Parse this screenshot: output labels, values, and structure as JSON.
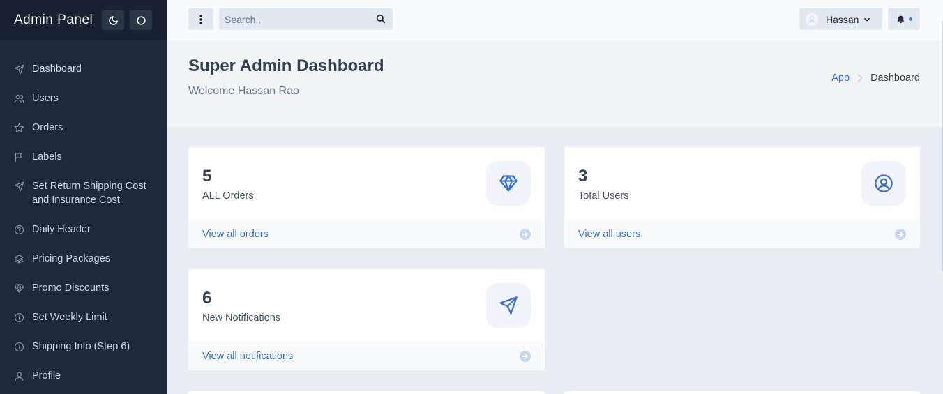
{
  "brand": {
    "title": "Admin Panel",
    "moon_icon": "moon-icon",
    "circle_icon": "circle-icon"
  },
  "sidebar": {
    "items": [
      {
        "label": "Dashboard",
        "icon": "send-icon"
      },
      {
        "label": "Users",
        "icon": "users-icon"
      },
      {
        "label": "Orders",
        "icon": "star-icon"
      },
      {
        "label": "Labels",
        "icon": "flag-icon"
      },
      {
        "label": "Set Return Shipping Cost and Insurance Cost",
        "icon": "send-icon"
      },
      {
        "label": "Daily Header",
        "icon": "help-circle-icon"
      },
      {
        "label": "Pricing Packages",
        "icon": "layers-icon"
      },
      {
        "label": "Promo Discounts",
        "icon": "diamond-icon"
      },
      {
        "label": "Set Weekly Limit",
        "icon": "info-icon"
      },
      {
        "label": "Shipping Info (Step 6)",
        "icon": "info-icon"
      },
      {
        "label": "Profile",
        "icon": "user-icon"
      }
    ]
  },
  "topbar": {
    "search_placeholder": "Search..",
    "user_name": "Hassan"
  },
  "header": {
    "title": "Super Admin Dashboard",
    "subtitle": "Welcome Hassan Rao",
    "breadcrumb": {
      "parent": "App",
      "current": "Dashboard"
    }
  },
  "cards": [
    {
      "value": "5",
      "label": "ALL Orders",
      "link": "View all orders",
      "icon": "diamond-icon"
    },
    {
      "value": "3",
      "label": "Total Users",
      "link": "View all users",
      "icon": "user-circle-icon"
    },
    {
      "value": "6",
      "label": "New Notifications",
      "link": "View all notifications",
      "icon": "send-icon"
    }
  ],
  "colors": {
    "sidebar": "#1e293b",
    "accent": "#3b6fd4",
    "background": "#eaedf1"
  }
}
